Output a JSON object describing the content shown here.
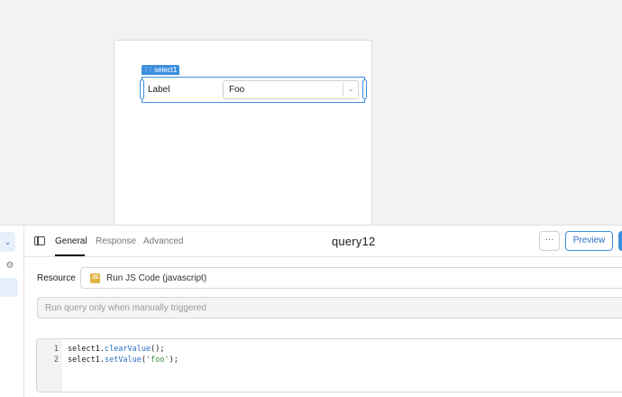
{
  "canvas": {
    "component_tag": "select1",
    "component_label": "Label",
    "select_value": "Foo"
  },
  "query_panel": {
    "tabs": [
      "General",
      "Response",
      "Advanced"
    ],
    "active_tab": "General",
    "query_name": "query12",
    "more_label": "···",
    "preview_label": "Preview",
    "resource_label": "Resource",
    "resource_badge": "JS",
    "resource_value": "Run JS Code (javascript)",
    "trigger_placeholder": "Run query only when manually triggered",
    "code_lines": [
      {
        "num": "1",
        "obj": "select1.",
        "fn": "clearValue",
        "rest": "();",
        "str": ""
      },
      {
        "num": "2",
        "obj": "select1.",
        "fn": "setValue",
        "rest": "(",
        "str": "'foo'",
        "end": ");"
      }
    ]
  },
  "icons": {
    "chevron": "chevron-down-icon",
    "sidebar_toggle": "sidebar-toggle-icon",
    "sliders": "sliders-icon",
    "more": "more-horizontal-icon"
  },
  "colors": {
    "accent": "#3d8fde",
    "js_badge": "#e2b541"
  }
}
